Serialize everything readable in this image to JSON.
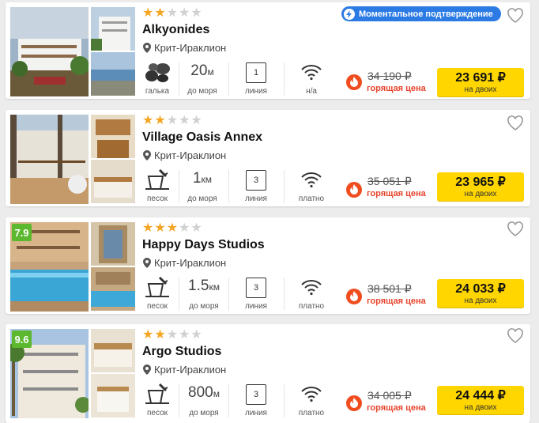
{
  "colors": {
    "accent_yellow": "#ffd600",
    "hot_red": "#e8442d",
    "badge_green": "#5cb82e",
    "instant_blue": "#2c7be5",
    "star": "#f5a623"
  },
  "instant_badge": "Моментальное подтверждение",
  "hotels": [
    {
      "rating": "",
      "stars": 2,
      "name": "Alkyonides",
      "location": "Крит-Ираклион",
      "beach_type": "галька",
      "distance": "20",
      "distance_unit": "м",
      "distance_label": "до моря",
      "line": "1",
      "line_label": "линия",
      "wifi_label": "н/а",
      "old_price": "34 190 ₽",
      "hot_label": "горящая цена",
      "price": "23 691 ₽",
      "price_note": "на двоих",
      "instant": true
    },
    {
      "rating": "",
      "stars": 2,
      "name": "Village Oasis Annex",
      "location": "Крит-Ираклион",
      "beach_type": "песок",
      "distance": "1",
      "distance_unit": "км",
      "distance_label": "до моря",
      "line": "3",
      "line_label": "линия",
      "wifi_label": "платно",
      "old_price": "35 051 ₽",
      "hot_label": "горящая цена",
      "price": "23 965 ₽",
      "price_note": "на двоих",
      "instant": false
    },
    {
      "rating": "7.9",
      "stars": 3,
      "name": "Happy Days Studios",
      "location": "Крит-Ираклион",
      "beach_type": "песок",
      "distance": "1.5",
      "distance_unit": "км",
      "distance_label": "до моря",
      "line": "3",
      "line_label": "линия",
      "wifi_label": "платно",
      "old_price": "38 501 ₽",
      "hot_label": "горящая цена",
      "price": "24 033 ₽",
      "price_note": "на двоих",
      "instant": false
    },
    {
      "rating": "9.6",
      "stars": 2,
      "name": "Argo Studios",
      "location": "Крит-Ираклион",
      "beach_type": "песок",
      "distance": "800",
      "distance_unit": "м",
      "distance_label": "до моря",
      "line": "3",
      "line_label": "линия",
      "wifi_label": "платно",
      "old_price": "34 005 ₽",
      "hot_label": "горящая цена",
      "price": "24 444 ₽",
      "price_note": "на двоих",
      "instant": false
    }
  ]
}
